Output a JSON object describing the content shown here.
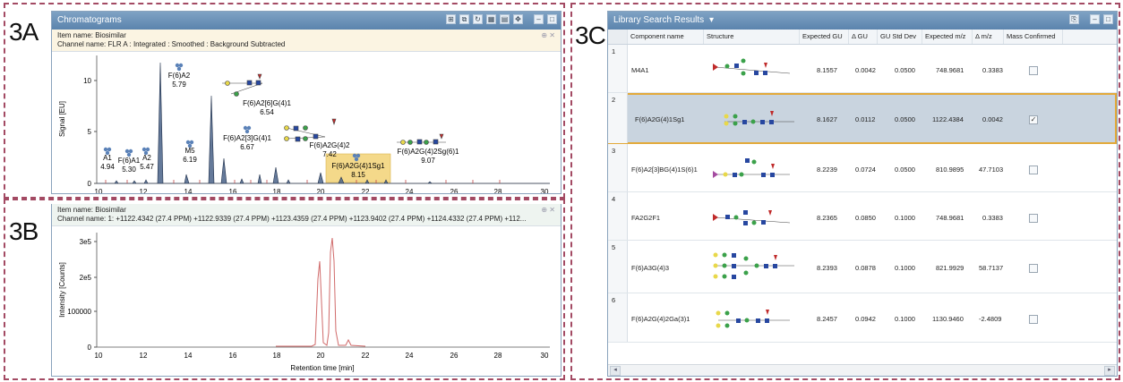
{
  "labels": {
    "a": "3A",
    "b": "3B",
    "c": "3C"
  },
  "chromatogram": {
    "title": "Chromatograms",
    "item_name": "Item name: Biosimilar",
    "channel_name": "Channel name: FLR A : Integrated : Smoothed : Background Subtracted",
    "y_label": "Signal [EU]",
    "x_ticks": [
      "10",
      "12",
      "14",
      "16",
      "18",
      "20",
      "22",
      "24",
      "26",
      "28",
      "30"
    ],
    "y_ticks": [
      "0",
      "5",
      "10"
    ],
    "peak_labels": [
      {
        "name": "A1",
        "gu": "4.94"
      },
      {
        "name": "F(6)A1",
        "gu": "5.30"
      },
      {
        "name": "A2",
        "gu": "5.47"
      },
      {
        "name": "F(6)A2",
        "gu": "5.79"
      },
      {
        "name": "M5",
        "gu": "6.19"
      },
      {
        "name": "F(6)A2[6]G(4)1",
        "gu": "6.54"
      },
      {
        "name": "F(6)A2[3]G(4)1",
        "gu": "6.67"
      },
      {
        "name": "F(6)A2G(4)2",
        "gu": "7.42"
      },
      {
        "name": "F(6)A2G(4)1Sg1",
        "gu": "8.15"
      },
      {
        "name": "F(6)A2G(4)2Sg(6)1",
        "gu": "9.07"
      }
    ],
    "accent": "#f4d98a"
  },
  "extracted": {
    "item_name": "Item name: Biosimilar",
    "channel_name": "Channel name: 1: +1122.4342 (27.4 PPM) +1122.9339 (27.4 PPM) +1123.4359 (27.4 PPM) +1123.9402 (27.4 PPM) +1124.4332 (27.4 PPM) +112...",
    "y_label": "Intensity [Counts]",
    "x_label": "Retention time [min]",
    "x_ticks": [
      "10",
      "12",
      "14",
      "16",
      "18",
      "20",
      "22",
      "24",
      "26",
      "28",
      "30"
    ],
    "y_ticks": [
      "0",
      "100000",
      "2e5",
      "3e5"
    ]
  },
  "library": {
    "title": "Library Search Results",
    "columns": [
      "Component name",
      "Structure",
      "Expected GU",
      "Δ GU",
      "GU Std Dev",
      "Expected m/z",
      "Δ m/z",
      "Mass Confirmed"
    ],
    "rows": [
      {
        "num": "1",
        "name": "M4A1",
        "gu": "8.1557",
        "dgu": "0.0042",
        "std": "0.0500",
        "mz": "748.9681",
        "dmz": "0.3383",
        "confirmed": false
      },
      {
        "num": "2",
        "name": "F(6)A2G(4)1Sg1",
        "gu": "8.1627",
        "dgu": "0.0112",
        "std": "0.0500",
        "mz": "1122.4384",
        "dmz": "0.0042",
        "confirmed": true
      },
      {
        "num": "3",
        "name": "F(6)A2[3]BG(4)1S(6)1",
        "gu": "8.2239",
        "dgu": "0.0724",
        "std": "0.0500",
        "mz": "810.9895",
        "dmz": "47.7103",
        "confirmed": false
      },
      {
        "num": "4",
        "name": "FA2G2F1",
        "gu": "8.2365",
        "dgu": "0.0850",
        "std": "0.1000",
        "mz": "748.9681",
        "dmz": "0.3383",
        "confirmed": false
      },
      {
        "num": "5",
        "name": "F(6)A3G(4)3",
        "gu": "8.2393",
        "dgu": "0.0878",
        "std": "0.1000",
        "mz": "821.9929",
        "dmz": "58.7137",
        "confirmed": false
      },
      {
        "num": "6",
        "name": "F(6)A2G(4)2Ga(3)1",
        "gu": "8.2457",
        "dgu": "0.0942",
        "std": "0.1000",
        "mz": "1130.9460",
        "dmz": "-2.4809",
        "confirmed": false
      }
    ],
    "check_mark": "✓"
  },
  "icons": {
    "arrow_left": "◂",
    "arrow_right": "▸",
    "dropdown": "▾",
    "pin": "⊕ ✕"
  }
}
